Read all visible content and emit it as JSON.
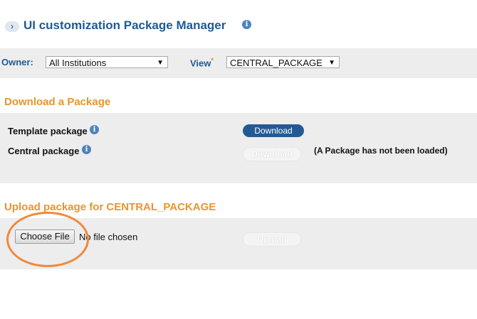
{
  "header": {
    "chevron": "›",
    "title": "UI customization Package Manager",
    "info_icon": "i"
  },
  "filters": {
    "owner_label": "Owner:",
    "owner_value": "All Institutions",
    "view_label": "View",
    "view_required": "*",
    "view_value": "CENTRAL_PACKAGE",
    "dropdown_arrow": "▼"
  },
  "download_section": {
    "title": "Download a Package",
    "template_label": "Template package",
    "central_label": "Central package",
    "download_button": "Download",
    "central_download_button": "Download",
    "central_note": "(A Package has not been loaded)"
  },
  "upload_section": {
    "title": "Upload package for CENTRAL_PACKAGE",
    "choose_file_button": "Choose File",
    "file_status": "No file chosen",
    "upload_button": "Upload"
  },
  "colors": {
    "header_blue": "#1e5b94",
    "section_orange": "#e8952c",
    "annotation_circle": "#f0893a"
  }
}
